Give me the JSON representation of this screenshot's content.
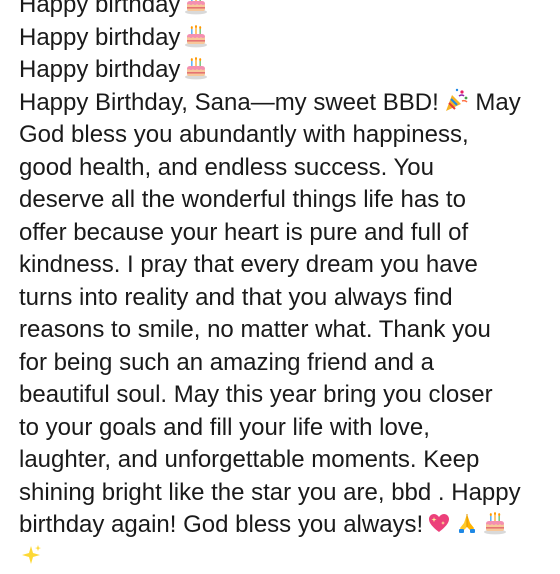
{
  "message": {
    "lines": [
      "Happy birthday",
      "Happy birthday",
      "Happy birthday",
      "Happy Birthday, Sana—my sweet BBD!",
      "May",
      "God bless you abundantly with happiness,",
      "good health, and endless success. You",
      "deserve all the wonderful things life has to",
      "offer because your heart is pure and full of",
      "kindness. I pray that every dream you have",
      "turns into reality and that you always find",
      "reasons to smile, no matter what. Thank you",
      "for being such an amazing friend and a",
      "beautiful soul. May this year bring you closer",
      "to your goals and fill your life with love,",
      "laughter, and unforgettable moments. Keep",
      "shining bright like the star you are, bbd . Happy",
      "birthday again! God bless you always!"
    ],
    "emojis": {
      "cake": "birthday-cake-icon",
      "party": "party-popper-icon",
      "heart": "sparkling-heart-icon",
      "pray": "folded-hands-icon",
      "sparkle": "sparkles-icon"
    }
  }
}
